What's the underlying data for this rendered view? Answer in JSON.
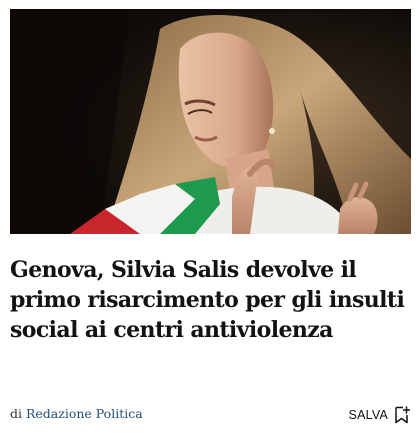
{
  "article": {
    "image_alt": "",
    "headline": "Genova, Silvia Salis devolve il primo risarcimento per gli insulti social ai centri antiviolenza",
    "byline_prefix": "di",
    "author": "Redazione Politica",
    "save_label": "SALVA",
    "icons": {
      "save": "bookmark-add-icon"
    },
    "colors": {
      "headline": "#121212",
      "author_link": "#1f4e79",
      "sash_green": "#1e9a4e",
      "sash_white": "#f4f4f2",
      "sash_red": "#c8262c"
    }
  }
}
